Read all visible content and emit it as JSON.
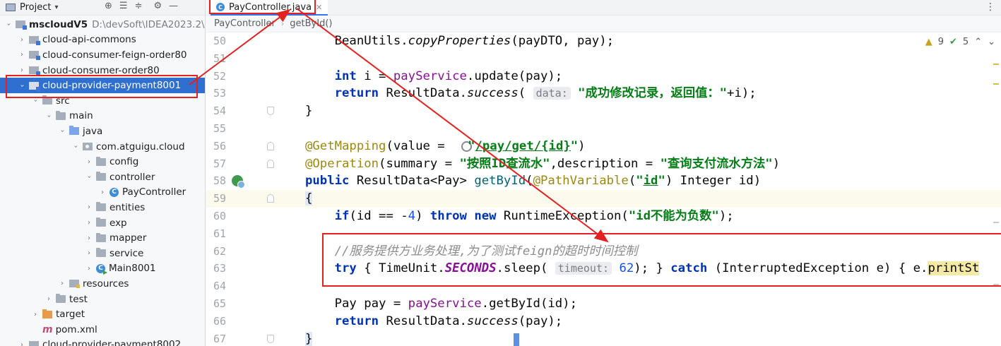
{
  "project_panel": {
    "title": "Project",
    "tree": [
      {
        "label": "mscloudV5",
        "path": "D:\\devSoft\\IDEA2023.2\\",
        "indent": 0,
        "expanded": true,
        "icon": "module",
        "bold": true
      },
      {
        "label": "cloud-api-commons",
        "indent": 1,
        "expanded": false,
        "icon": "module"
      },
      {
        "label": "cloud-consumer-feign-order80",
        "indent": 1,
        "expanded": false,
        "icon": "module"
      },
      {
        "label": "cloud-consumer-order80",
        "indent": 1,
        "expanded": false,
        "icon": "module"
      },
      {
        "label": "cloud-provider-payment8001",
        "indent": 1,
        "expanded": true,
        "icon": "module",
        "selected": true
      },
      {
        "label": "src",
        "indent": 2,
        "expanded": true,
        "icon": "folder"
      },
      {
        "label": "main",
        "indent": 3,
        "expanded": true,
        "icon": "folder"
      },
      {
        "label": "java",
        "indent": 4,
        "expanded": true,
        "icon": "src"
      },
      {
        "label": "com.atguigu.cloud",
        "indent": 5,
        "expanded": true,
        "icon": "pkg"
      },
      {
        "label": "config",
        "indent": 6,
        "expanded": false,
        "icon": "folder"
      },
      {
        "label": "controller",
        "indent": 6,
        "expanded": true,
        "icon": "folder"
      },
      {
        "label": "PayController",
        "indent": 7,
        "expanded": false,
        "icon": "cls"
      },
      {
        "label": "entities",
        "indent": 6,
        "expanded": false,
        "icon": "folder"
      },
      {
        "label": "exp",
        "indent": 6,
        "expanded": false,
        "icon": "folder"
      },
      {
        "label": "mapper",
        "indent": 6,
        "expanded": false,
        "icon": "folder"
      },
      {
        "label": "service",
        "indent": 6,
        "expanded": false,
        "icon": "folder"
      },
      {
        "label": "Main8001",
        "indent": 6,
        "expanded": false,
        "icon": "main"
      },
      {
        "label": "resources",
        "indent": 4,
        "expanded": false,
        "icon": "res"
      },
      {
        "label": "test",
        "indent": 3,
        "expanded": false,
        "icon": "folder"
      },
      {
        "label": "target",
        "indent": 2,
        "expanded": false,
        "icon": "target"
      },
      {
        "label": "pom.xml",
        "indent": 2,
        "leaf": true,
        "icon": "maven"
      },
      {
        "label": "cloud-provider-payment8002",
        "indent": 1,
        "expanded": false,
        "icon": "module"
      }
    ]
  },
  "editor": {
    "tab_label": "PayController.java",
    "breadcrumb": [
      "PayController",
      "getById()"
    ],
    "inspections": {
      "warnings": "9",
      "ok": "5"
    },
    "line_numbers": [
      "50",
      "51",
      "52",
      "53",
      "54",
      "55",
      "56",
      "57",
      "58",
      "59",
      "60",
      "61",
      "62",
      "63",
      "64",
      "65",
      "66",
      "67"
    ],
    "highlighted_line": "59",
    "inlay_hints": {
      "data": "data:",
      "timeout": "timeout:"
    },
    "comment_text": "//服务提供方业务处理,为了测试feign的超时时间控制",
    "strings": {
      "success_msg": "\"成功修改记录，返回值：\"",
      "path": "/pay/get/{id}",
      "summary": "\"按照ID查流水\"",
      "description": "\"查询支付流水方法\"",
      "path_var": "id",
      "exception_msg": "\"id不能为负数\""
    }
  },
  "annotation_color": "#e42020"
}
